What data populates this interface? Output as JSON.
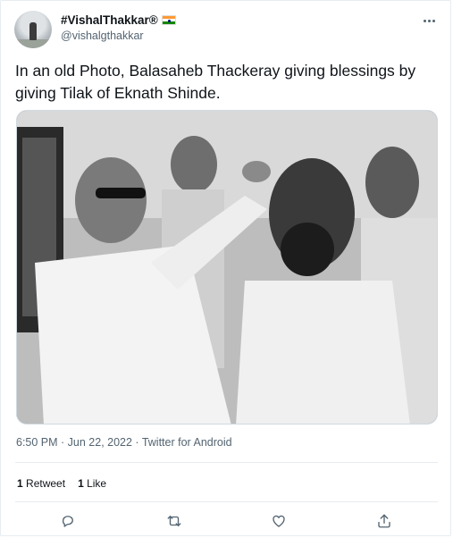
{
  "author": {
    "display_name": "#VishalThakkar®",
    "handle": "@vishalgthakkar",
    "avatar_icon": "user-avatar",
    "flag_icon": "india-flag-icon"
  },
  "tweet": {
    "text": "In an old Photo, Balasaheb Thackeray giving blessings by giving Tilak of Eknath Shinde.",
    "timestamp": "6:50 PM · Jun 22, 2022 · Twitter for Android"
  },
  "stats": {
    "retweets_count": "1",
    "retweets_label": "Retweet",
    "likes_count": "1",
    "likes_label": "Like"
  },
  "actions": {
    "reply_icon": "reply-icon",
    "retweet_icon": "retweet-icon",
    "like_icon": "heart-icon",
    "share_icon": "share-icon"
  },
  "colors": {
    "text_primary": "#0f1419",
    "text_secondary": "#536471",
    "border": "#e6ecf0"
  }
}
